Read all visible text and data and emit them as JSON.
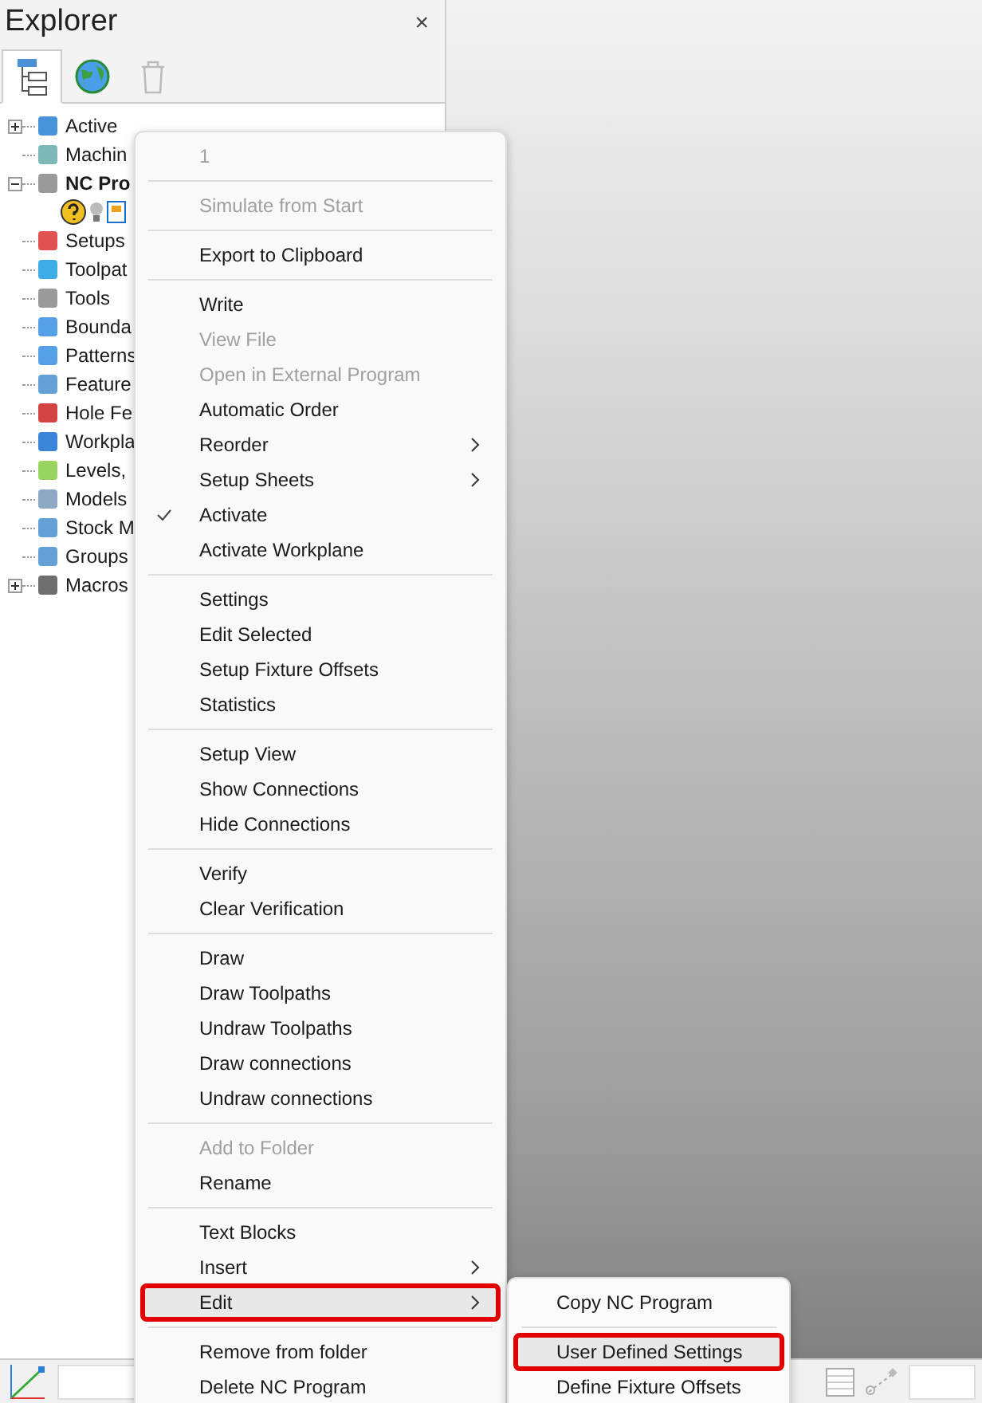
{
  "panel": {
    "title": "Explorer",
    "close": "×"
  },
  "tabs": [
    {
      "selected": true
    },
    {
      "selected": false
    },
    {
      "selected": false
    }
  ],
  "tree": [
    {
      "label": "Active",
      "expanded": false,
      "active": false
    },
    {
      "label": "Machin",
      "active": false
    },
    {
      "label": "NC Pro",
      "expanded": true,
      "active": true,
      "children": [
        {
          "kind": "status-icons"
        }
      ]
    },
    {
      "label": "Setups",
      "active": false
    },
    {
      "label": "Toolpat",
      "active": false
    },
    {
      "label": "Tools",
      "active": false
    },
    {
      "label": "Bounda",
      "active": false
    },
    {
      "label": "Patterns",
      "active": false
    },
    {
      "label": "Feature",
      "active": false
    },
    {
      "label": "Hole Fe",
      "active": false
    },
    {
      "label": "Workpla",
      "active": false
    },
    {
      "label": "Levels,",
      "active": false
    },
    {
      "label": "Models",
      "active": false
    },
    {
      "label": "Stock M",
      "active": false
    },
    {
      "label": "Groups",
      "active": false
    },
    {
      "label": "Macros",
      "expanded": false,
      "active": false
    }
  ],
  "context_menu": {
    "groups": [
      [
        {
          "label": "1",
          "disabled": true
        }
      ],
      [
        {
          "label": "Simulate from Start",
          "disabled": true
        }
      ],
      [
        {
          "label": "Export to Clipboard",
          "disabled": false
        }
      ],
      [
        {
          "label": "Write",
          "disabled": false
        },
        {
          "label": "View File",
          "disabled": true
        },
        {
          "label": "Open in External Program",
          "disabled": true
        },
        {
          "label": "Automatic Order",
          "disabled": false
        },
        {
          "label": "Reorder",
          "disabled": false,
          "submenu": true
        },
        {
          "label": "Setup Sheets",
          "disabled": false,
          "submenu": true
        },
        {
          "label": "Activate",
          "disabled": false,
          "checked": true
        },
        {
          "label": "Activate Workplane",
          "disabled": false
        }
      ],
      [
        {
          "label": "Settings",
          "disabled": false
        },
        {
          "label": "Edit Selected",
          "disabled": false
        },
        {
          "label": "Setup Fixture Offsets",
          "disabled": false
        },
        {
          "label": "Statistics",
          "disabled": false
        }
      ],
      [
        {
          "label": "Setup View",
          "disabled": false
        },
        {
          "label": "Show Connections",
          "disabled": false
        },
        {
          "label": "Hide Connections",
          "disabled": false
        }
      ],
      [
        {
          "label": "Verify",
          "disabled": false
        },
        {
          "label": "Clear Verification",
          "disabled": false
        }
      ],
      [
        {
          "label": "Draw",
          "disabled": false
        },
        {
          "label": "Draw Toolpaths",
          "disabled": false
        },
        {
          "label": "Undraw Toolpaths",
          "disabled": false
        },
        {
          "label": "Draw connections",
          "disabled": false
        },
        {
          "label": "Undraw connections",
          "disabled": false
        }
      ],
      [
        {
          "label": "Add to Folder",
          "disabled": true
        },
        {
          "label": "Rename",
          "disabled": false
        }
      ],
      [
        {
          "label": "Text Blocks",
          "disabled": false
        },
        {
          "label": "Insert",
          "disabled": false,
          "submenu": true
        },
        {
          "label": "Edit",
          "disabled": false,
          "submenu": true,
          "selected": true,
          "outlined": true
        }
      ],
      [
        {
          "label": "Remove from folder",
          "disabled": false
        },
        {
          "label": "Delete NC Program",
          "disabled": false
        }
      ]
    ]
  },
  "submenu": {
    "groups": [
      [
        {
          "label": "Copy NC Program",
          "selected": false,
          "outlined": false
        }
      ],
      [
        {
          "label": "User Defined Settings",
          "selected": true,
          "outlined": true
        },
        {
          "label": "Define Fixture Offsets",
          "selected": false,
          "outlined": false
        }
      ]
    ]
  }
}
